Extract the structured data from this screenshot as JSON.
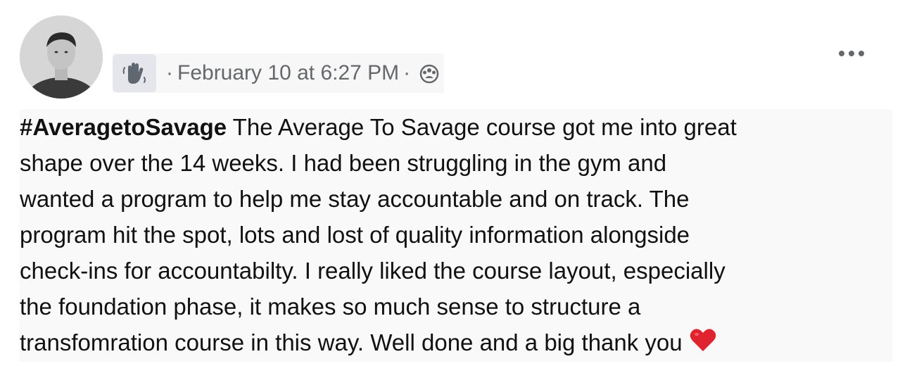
{
  "post": {
    "timestamp": "February 10 at 6:27 PM",
    "separator": "·",
    "audience_icon": "group-icon",
    "badge_icon": "waving-hand-icon",
    "more_icon": "more-options-icon",
    "hashtag": "#AveragetoSavage",
    "lines": [
      " The Average To Savage course got me into great",
      "shape over the 14 weeks. I had been struggling in the gym and",
      "wanted a program to help me stay accountable and on track. The",
      "program hit the spot, lots and lost of quality information alongside",
      "check-ins for accountabilty. I really liked the course layout, especially",
      "the foundation phase, it makes so much sense to structure a",
      "transfomration course in this way. Well done and a big thank you"
    ],
    "emoji": "heart-emoji",
    "colors": {
      "meta_text": "#65676b",
      "badge_bg": "#e4e6eb",
      "heart": "#e0242f"
    }
  }
}
